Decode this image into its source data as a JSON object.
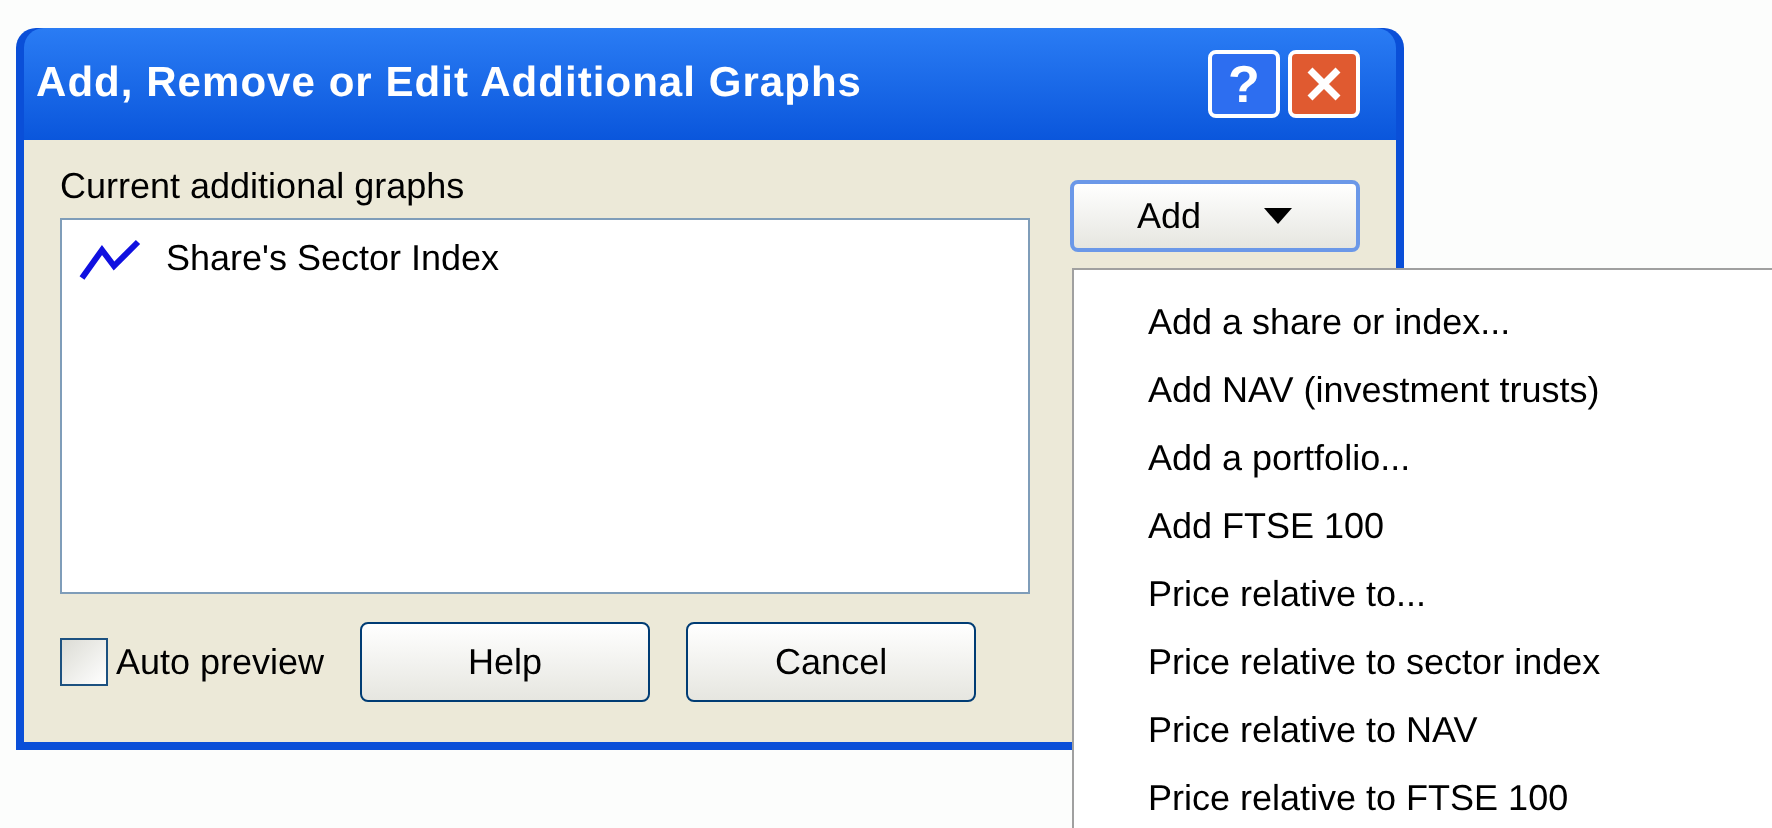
{
  "window": {
    "title": "Add, Remove or Edit Additional Graphs"
  },
  "title_buttons": [
    {
      "kind": "help",
      "label": "?"
    },
    {
      "kind": "close"
    }
  ],
  "list_label": "Current additional graphs",
  "graphs": [
    {
      "name": "Share's Sector Index",
      "color": "#1010e0"
    }
  ],
  "add_button": {
    "label": "Add"
  },
  "auto_preview": {
    "label": "Auto preview",
    "checked": false
  },
  "buttons": [
    "Help",
    "Cancel"
  ],
  "menu": [
    "Add a share or index...",
    "Add NAV (investment trusts)",
    "Add a portfolio...",
    "Add FTSE 100",
    "Price relative to...",
    "Price relative to sector index",
    "Price relative to NAV",
    "Price relative to FTSE 100"
  ]
}
